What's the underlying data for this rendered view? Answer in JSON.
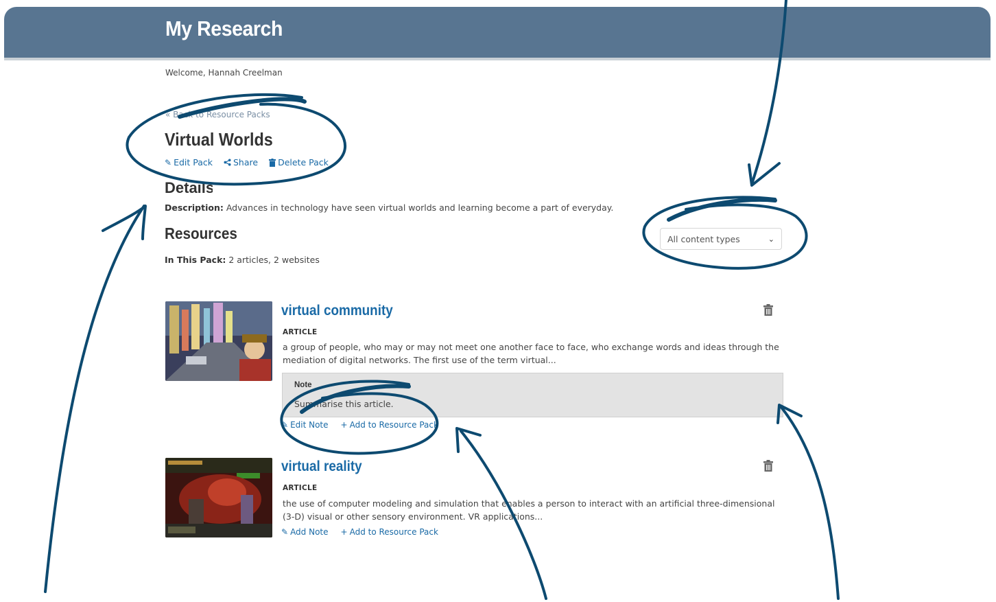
{
  "header": {
    "title": "My Research"
  },
  "welcome": "Welcome, Hannah Creelman",
  "back_link": "« Back to Resource Packs",
  "pack": {
    "title": "Virtual Worlds",
    "actions": {
      "edit": {
        "icon": "pencil-icon",
        "label": "Edit Pack"
      },
      "share": {
        "icon": "share-icon",
        "label": "Share"
      },
      "delete": {
        "icon": "trash-icon",
        "label": "Delete Pack"
      }
    }
  },
  "details": {
    "heading": "Details",
    "description_label": "Description:",
    "description_text": "Advances in technology have seen virtual worlds and learning become a part of everyday."
  },
  "resources": {
    "heading": "Resources",
    "in_pack_label": "In This Pack:",
    "in_pack_value": "2 articles, 2 websites",
    "filter": {
      "selected": "All content types"
    },
    "items": [
      {
        "title": "virtual community",
        "type": "ARTICLE",
        "description": "a group of people, who may or may not meet one another face to face, who exchange words and ideas through the mediation of digital networks. The first use of the term virtual...",
        "note": {
          "label": "Note",
          "text": "Summarise this article."
        },
        "actions": {
          "edit_note": "Edit Note",
          "add_to_pack": "Add to Resource Pack"
        }
      },
      {
        "title": "virtual reality",
        "type": "ARTICLE",
        "description": "the use of computer modeling and simulation that enables a person to interact with an artificial three-dimensional (3-D) visual or other sensory environment. VR applications...",
        "actions": {
          "add_note": "Add Note",
          "add_to_pack": "Add to Resource Pack"
        }
      }
    ]
  },
  "colors": {
    "header_bg": "#587591",
    "link": "#1a6aa6",
    "annotation": "#0d4a70",
    "note_bg": "#e3e3e3"
  }
}
